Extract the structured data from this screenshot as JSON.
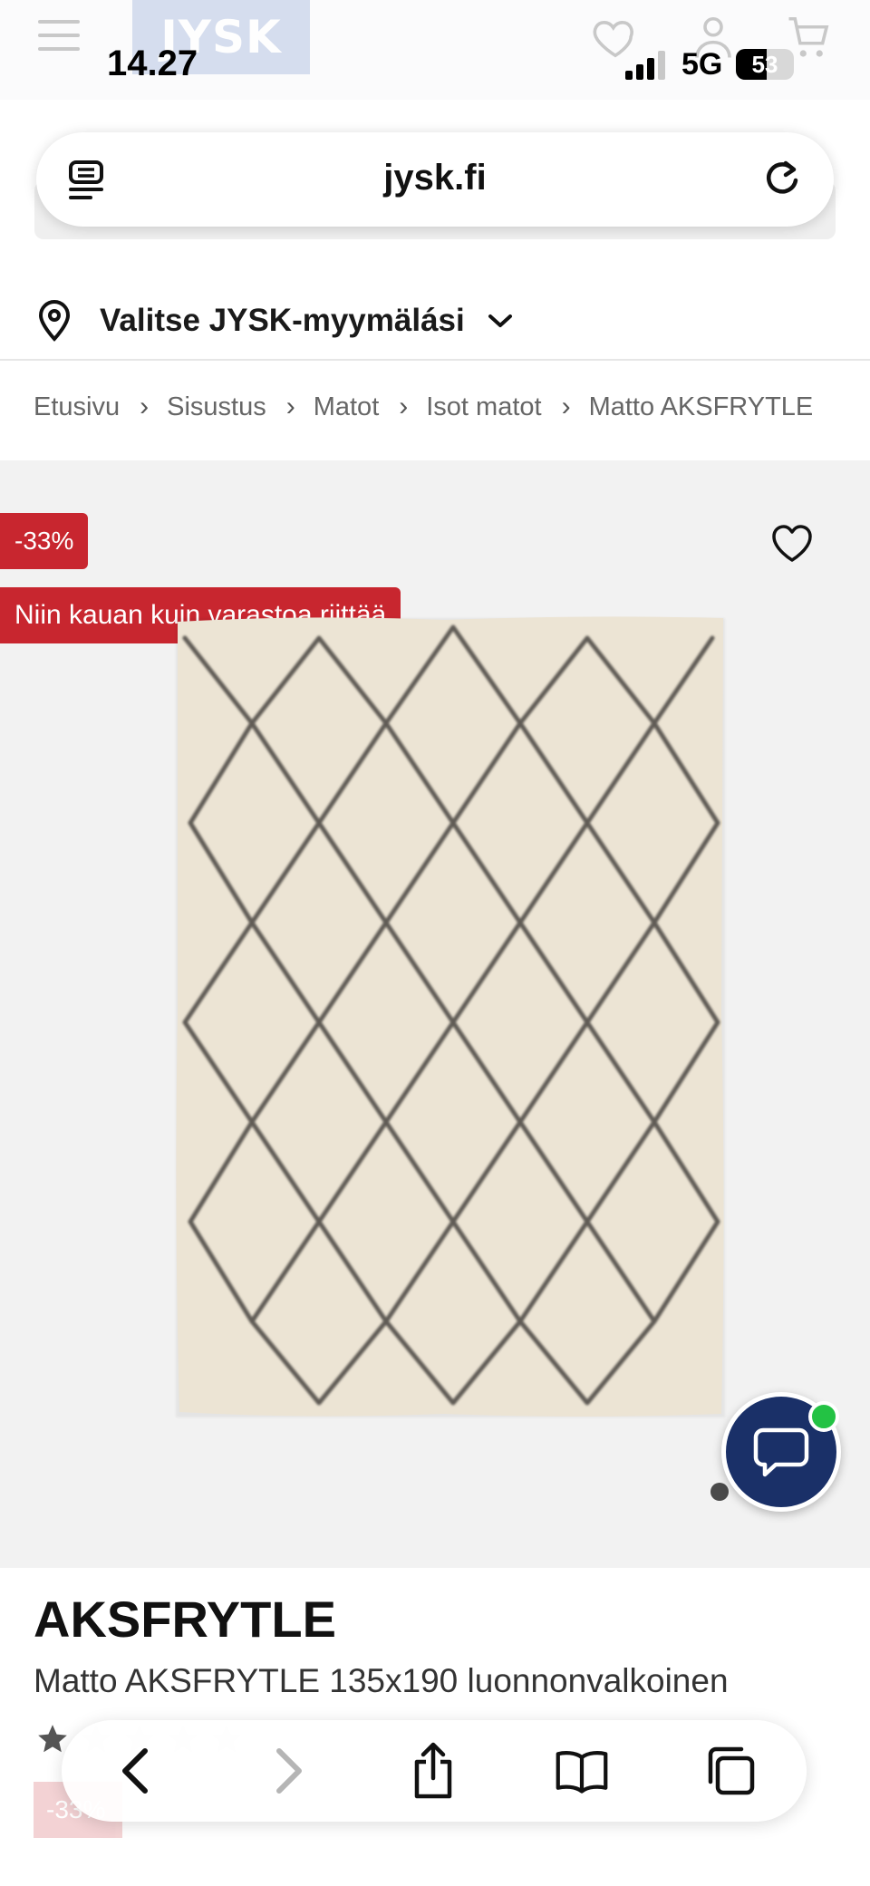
{
  "status_bar": {
    "time": "14.27",
    "network": "5G",
    "battery": "53",
    "battery_level": 0.53
  },
  "site_header": {
    "logo_text": "JYSK"
  },
  "browser": {
    "address": "jysk.fi"
  },
  "store_selector": {
    "label": "Valitse JYSK-myymälási"
  },
  "breadcrumb": {
    "items": [
      "Etusivu",
      "Sisustus",
      "Matot",
      "Isot matot",
      "Matto AKSFRYTLE"
    ],
    "separator": "›"
  },
  "gallery": {
    "discount_badge": "-33%",
    "stock_badge": "Niin kauan kuin varastoa riittää",
    "active_image": 1
  },
  "product": {
    "name": "AKSFRYTLE",
    "description": "Matto AKSFRYTLE 135x190 luonnonvalkoinen",
    "rating_stars": 5,
    "discount_badge": "-33%"
  },
  "colors": {
    "badge_red": "#c8262f",
    "chat_navy": "#1a3068",
    "online_green": "#23c244",
    "gallery_bg": "#f2f2f2"
  },
  "icons": {
    "menu": "hamburger-icon",
    "wishlist": "heart-icon",
    "account": "user-icon",
    "cart": "cart-icon",
    "reader": "reader-mode-icon",
    "reload": "reload-icon",
    "location": "map-pin-icon",
    "chat": "chat-bubble-icon",
    "back": "chevron-left-icon",
    "forward": "chevron-right-icon",
    "share": "share-icon",
    "bookmarks": "book-icon",
    "tabs": "tabs-icon"
  }
}
